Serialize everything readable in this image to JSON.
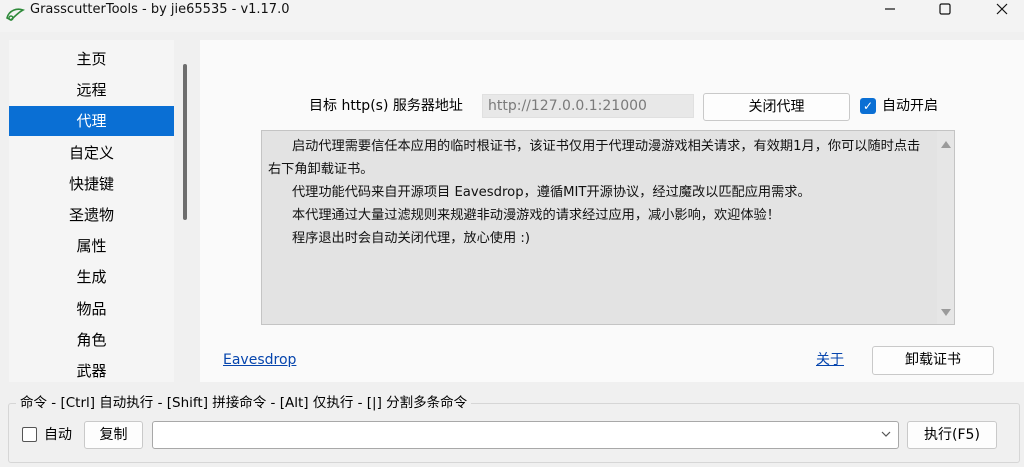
{
  "window": {
    "title": "GrasscutterTools  - by jie65535  - v1.17.0"
  },
  "sidebar": {
    "items": [
      {
        "label": "主页",
        "active": false
      },
      {
        "label": "远程",
        "active": false
      },
      {
        "label": "代理",
        "active": true
      },
      {
        "label": "自定义",
        "active": false
      },
      {
        "label": "快捷键",
        "active": false
      },
      {
        "label": "圣遗物",
        "active": false
      },
      {
        "label": "属性",
        "active": false
      },
      {
        "label": "生成",
        "active": false
      },
      {
        "label": "物品",
        "active": false
      },
      {
        "label": "角色",
        "active": false
      },
      {
        "label": "武器",
        "active": false
      }
    ]
  },
  "proxy": {
    "target_label": "目标 http(s) 服务器地址",
    "target_value": "http://127.0.0.1:21000",
    "close_button": "关闭代理",
    "autostart_label": "自动开启",
    "autostart_checked": true
  },
  "info": {
    "lines": [
      "启动代理需要信任本应用的临时根证书，该证书仅用于代理动漫游戏相关请求，有效期1月，你可以随时点击右下角卸载证书。",
      "代理功能代码来自开源项目 Eavesdrop，遵循MIT开源协议，经过魔改以匹配应用需求。",
      "本代理通过大量过滤规则来规避非动漫游戏的请求经过应用，减小影响，欢迎体验！",
      "程序退出时会自动关闭代理，放心使用 :)"
    ]
  },
  "footer": {
    "eavesdrop_link": "Eavesdrop",
    "about_link": "关于",
    "uninstall_button": "卸载证书"
  },
  "command": {
    "legend": "命令 - [Ctrl] 自动执行 - [Shift] 拼接命令 - [Alt] 仅执行 - [|] 分割多条命令",
    "auto_label": "自动",
    "auto_checked": false,
    "copy_button": "复制",
    "input_value": "",
    "exec_button": "执行(F5)"
  },
  "colors": {
    "accent": "#0a6fd4",
    "link": "#0645ad"
  }
}
